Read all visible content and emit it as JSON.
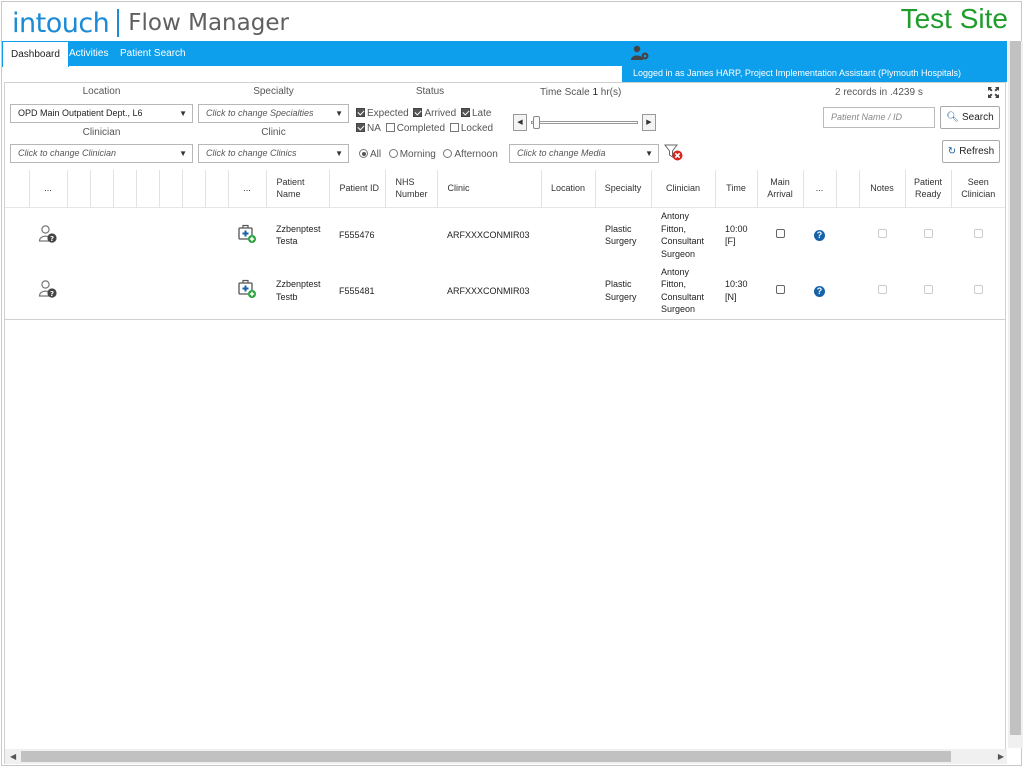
{
  "header": {
    "logo_brand": "intouch",
    "logo_product": "Flow Manager",
    "site_label": "Test Site",
    "logged_in_text": "Logged in as James HARP, Project Implementation Assistant (Plymouth Hospitals)"
  },
  "tabs": [
    {
      "label": "Dashboard",
      "active": true
    },
    {
      "label": "Activities",
      "active": false
    },
    {
      "label": "Patient Search",
      "active": false
    }
  ],
  "filters": {
    "location_label": "Location",
    "location_value": "OPD Main Outpatient Dept., L6",
    "specialty_label": "Specialty",
    "specialty_placeholder": "Click to change Specialties",
    "clinician_label": "Clinician",
    "clinician_placeholder": "Click to change Clinician",
    "clinic_label": "Clinic",
    "clinic_placeholder": "Click to change Clinics",
    "status_label": "Status",
    "status_options": [
      {
        "label": "Expected",
        "checked": true
      },
      {
        "label": "Arrived",
        "checked": true
      },
      {
        "label": "Late",
        "checked": true
      },
      {
        "label": "NA",
        "checked": true
      },
      {
        "label": "Completed",
        "checked": false
      },
      {
        "label": "Locked",
        "checked": false
      }
    ],
    "period_options": [
      {
        "label": "All",
        "selected": true
      },
      {
        "label": "Morning",
        "selected": false
      },
      {
        "label": "Afternoon",
        "selected": false
      }
    ],
    "media_placeholder": "Click to change Media",
    "time_scale_label": "Time Scale",
    "time_scale_value": "1",
    "time_scale_unit": "hr(s)",
    "records_text": "2 records in .4239 s",
    "search_placeholder": "Patient Name / ID",
    "search_button": "Search",
    "refresh_button": "Refresh"
  },
  "table": {
    "headers": {
      "more1": "...",
      "more2": "...",
      "patient_name": "Patient Name",
      "patient_id": "Patient ID",
      "nhs_number": "NHS Number",
      "clinic": "Clinic",
      "location": "Location",
      "specialty": "Specialty",
      "clinician": "Clinician",
      "time": "Time",
      "main_arrival": "Main Arrival",
      "more3": "...",
      "notes": "Notes",
      "patient_ready": "Patient Ready",
      "seen_clinician": "Seen Clinician"
    },
    "rows": [
      {
        "patient_name": "Zzbenptest Testa",
        "patient_id": "F555476",
        "nhs_number": "",
        "clinic": "ARFXXXCONMIR03",
        "location": "",
        "specialty": "Plastic Surgery",
        "clinician": "Antony Fitton, Consultant Surgeon",
        "time": "10:00 [F]"
      },
      {
        "patient_name": "Zzbenptest Testb",
        "patient_id": "F555481",
        "nhs_number": "",
        "clinic": "ARFXXXCONMIR03",
        "location": "",
        "specialty": "Plastic Surgery",
        "clinician": "Antony Fitton, Consultant Surgeon",
        "time": "10:30 [N]"
      }
    ]
  },
  "icons": {
    "user_settings": "user-settings-icon",
    "expand": "fullscreen-icon",
    "clear_filter": "clear-filter-icon",
    "patient_unknown": "user-question-icon",
    "add_record": "medical-add-icon",
    "help": "help-icon"
  },
  "colors": {
    "brand_blue": "#1b8bd6",
    "nav_blue": "#0d9fec",
    "test_site_green": "#1f9d2c",
    "help_blue": "#1662a8"
  }
}
